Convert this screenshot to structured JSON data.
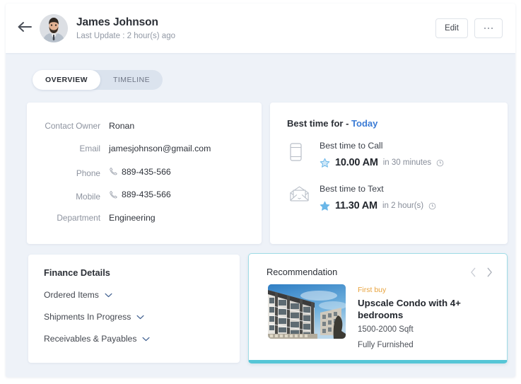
{
  "header": {
    "back_icon": "arrow-left-icon",
    "avatar_alt": "avatar",
    "contact_name": "James Johnson",
    "last_update": "Last Update : 2 hour(s) ago",
    "edit_label": "Edit",
    "more_icon": "ellipsis-icon"
  },
  "tabs": [
    {
      "label": "OVERVIEW",
      "active": true
    },
    {
      "label": "TIMELINE",
      "active": false
    }
  ],
  "contact": {
    "rows": [
      {
        "label": "Contact Owner",
        "value": "Ronan",
        "icon": ""
      },
      {
        "label": "Email",
        "value": "jamesjohnson@gmail.com",
        "icon": ""
      },
      {
        "label": "Phone",
        "value": "889-435-566",
        "icon": "phone-icon"
      },
      {
        "label": "Mobile",
        "value": "889-435-566",
        "icon": "phone-icon"
      },
      {
        "label": "Department",
        "value": "Engineering",
        "icon": ""
      }
    ]
  },
  "best_time": {
    "heading_prefix": "Best time for -",
    "heading_link": "Today",
    "items": [
      {
        "icon": "mobile-phone-icon",
        "label": "Best time to Call",
        "star_icon": "star-outline-icon",
        "time": "10.00 AM",
        "relative": "in 30 minutes",
        "clock_icon": "clock-icon"
      },
      {
        "icon": "envelope-icon",
        "label": "Best time to Text",
        "star_icon": "star-filled-icon",
        "time": "11.30 AM",
        "relative": "in 2 hour(s)",
        "clock_icon": "clock-icon"
      }
    ]
  },
  "finance": {
    "title": "Finance Details",
    "items": [
      {
        "label": "Ordered Items",
        "icon": "chevron-down-icon"
      },
      {
        "label": "Shipments In Progress",
        "icon": "chevron-down-icon"
      },
      {
        "label": "Receivables & Payables",
        "icon": "chevron-down-icon"
      }
    ]
  },
  "recommendation": {
    "title": "Recommendation",
    "prev_icon": "chevron-left-icon",
    "next_icon": "chevron-right-icon",
    "thumbnail_alt": "condo-building-photo",
    "tag": "First buy",
    "name": "Upscale Condo with 4+ bedrooms",
    "size": "1500-2000 Sqft",
    "furnishing": "Fully Furnished"
  },
  "colors": {
    "page_background": "#eef2f8",
    "card_background": "#ffffff",
    "accent_link": "#3a7bd5",
    "accent_teal": "#56c6d6",
    "accent_orange": "#e8a33d",
    "star_blue": "#6bb7e8",
    "text_primary": "#2b2f36",
    "text_muted": "#8d939f"
  }
}
